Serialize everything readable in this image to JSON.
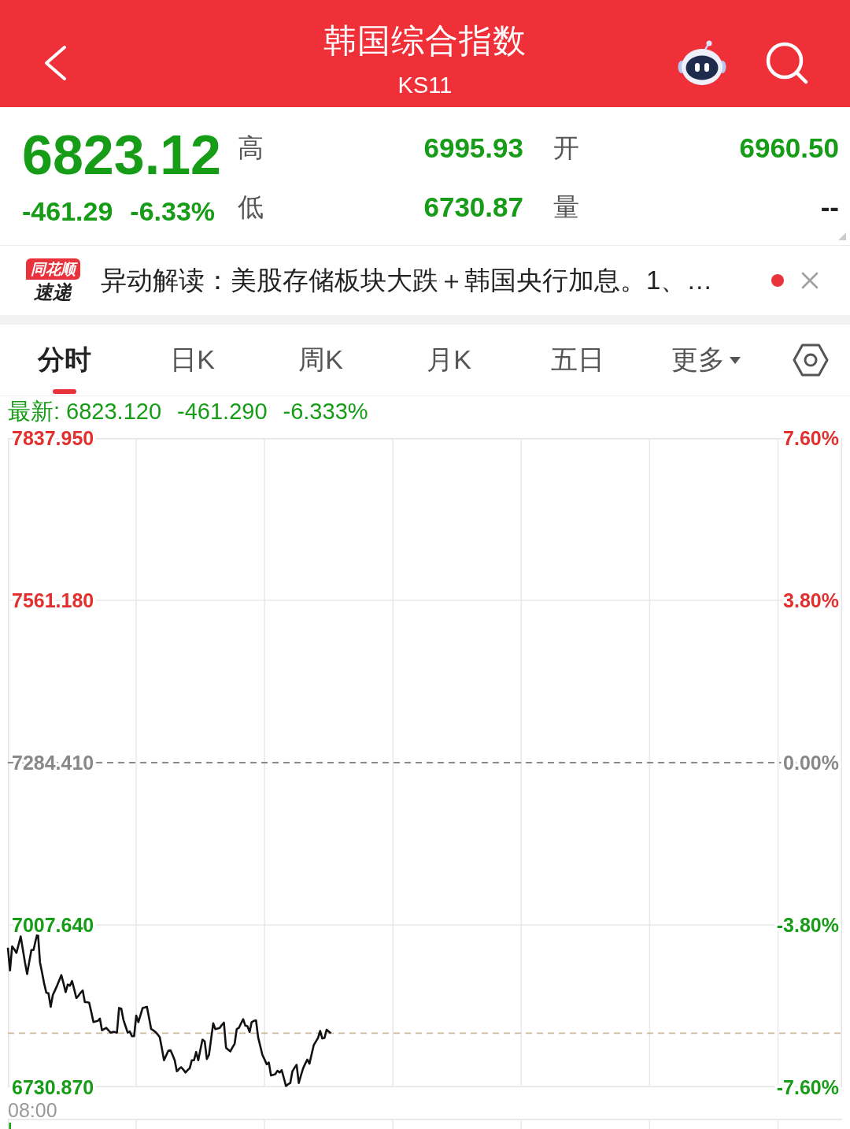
{
  "header": {
    "title": "韩国综合指数",
    "code": "KS11"
  },
  "quote": {
    "price": "6823.12",
    "change": "-461.29",
    "change_pct": "-6.33%",
    "falling": true,
    "stats": [
      {
        "label": "高",
        "value": "6995.93",
        "color": "#169c16"
      },
      {
        "label": "开",
        "value": "6960.50",
        "color": "#169c16"
      },
      {
        "label": "低",
        "value": "6730.87",
        "color": "#169c16"
      },
      {
        "label": "量",
        "value": "--",
        "color": "#222222"
      }
    ]
  },
  "news": {
    "logo_tag": "同花顺",
    "logo_text": "速递",
    "text": "异动解读：美股存储板块大跌＋韩国央行加息。1、…",
    "unread": true
  },
  "tabs": [
    {
      "label": "分时",
      "selected": true,
      "dropdown": false
    },
    {
      "label": "日K",
      "selected": false,
      "dropdown": false
    },
    {
      "label": "周K",
      "selected": false,
      "dropdown": false
    },
    {
      "label": "月K",
      "selected": false,
      "dropdown": false
    },
    {
      "label": "五日",
      "selected": false,
      "dropdown": false
    },
    {
      "label": "更多",
      "selected": false,
      "dropdown": true
    }
  ],
  "chart": {
    "latest_label": "最新:",
    "latest_price": "6823.120",
    "latest_change": "-461.290",
    "latest_pct": "-6.333%",
    "falling": true,
    "right_axis_labels": [
      "7.60%",
      "3.80%",
      "0.00%",
      "-3.80%",
      "-7.60%"
    ],
    "chart_data": {
      "type": "line",
      "ylim": [
        6730.87,
        7837.95
      ],
      "yticks": [
        {
          "value": 7837.95,
          "label": "7837.950"
        },
        {
          "value": 7561.18,
          "label": "7561.180"
        },
        {
          "value": 7284.41,
          "label": "7284.410"
        },
        {
          "value": 7007.64,
          "label": "7007.640"
        },
        {
          "value": 6730.87,
          "label": "6730.870"
        }
      ],
      "ref_lines": [
        {
          "axis": "y",
          "value": 7284.41,
          "color": "#8a8a8a"
        },
        {
          "axis": "y",
          "value": 6823.12,
          "color": "#cdb99a"
        }
      ],
      "annotations": [
        "08:00"
      ],
      "values": [
        6969,
        6930,
        6971,
        6966,
        6960,
        6974,
        6988,
        6966,
        6944,
        6924,
        6945,
        6965,
        6965,
        6981,
        6996,
        6944,
        6926,
        6907,
        6892,
        6891,
        6868,
        6888,
        6896,
        6904,
        6913,
        6922,
        6908,
        6893,
        6906,
        6904,
        6912,
        6898,
        6883,
        6887,
        6892,
        6896,
        6876,
        6876,
        6875,
        6859,
        6842,
        6843,
        6844,
        6848,
        6828,
        6830,
        6832,
        6828,
        6824,
        6825,
        6825,
        6824,
        6866,
        6865,
        6846,
        6835,
        6824,
        6826,
        6818,
        6818,
        6853,
        6842,
        6854,
        6866,
        6867,
        6868,
        6849,
        6830,
        6828,
        6825,
        6821,
        6816,
        6797,
        6777,
        6785,
        6793,
        6794,
        6786,
        6777,
        6758,
        6762,
        6765,
        6761,
        6756,
        6760,
        6763,
        6777,
        6777,
        6791,
        6777,
        6795,
        6812,
        6809,
        6779,
        6786,
        6813,
        6840,
        6830,
        6831,
        6832,
        6837,
        6841,
        6798,
        6795,
        6792,
        6799,
        6805,
        6830,
        6832,
        6840,
        6847,
        6836,
        6835,
        6825,
        6842,
        6844,
        6845,
        6816,
        6801,
        6786,
        6778,
        6770,
        6773,
        6751,
        6752,
        6753,
        6759,
        6756,
        6760,
        6747,
        6733,
        6736,
        6738,
        6758,
        6764,
        6769,
        6738,
        6751,
        6763,
        6771,
        6778,
        6771,
        6787,
        6803,
        6809,
        6815,
        6827,
        6814,
        6815,
        6829,
        6826,
        6823,
        null,
        null,
        null,
        null,
        null,
        null,
        null,
        null,
        null,
        null,
        null,
        null,
        null,
        null,
        null,
        null,
        null,
        null,
        null,
        null,
        null,
        null,
        null,
        null,
        null,
        null,
        null,
        null,
        null,
        null,
        null,
        null,
        null,
        null,
        null,
        null,
        null,
        null,
        null,
        null,
        null,
        null,
        null,
        null,
        null,
        null,
        null,
        null,
        null,
        null,
        null,
        null,
        null,
        null,
        null,
        null,
        null,
        null,
        null,
        null,
        null,
        null,
        null,
        null,
        null,
        null,
        null,
        null,
        null,
        null,
        null,
        null,
        null,
        null,
        null,
        null,
        null,
        null,
        null,
        null,
        null,
        null,
        null,
        null,
        null,
        null,
        null,
        null,
        null,
        null,
        null,
        null,
        null,
        null,
        null,
        null,
        null,
        null,
        null,
        null,
        null,
        null,
        null,
        null,
        null,
        null,
        null,
        null,
        null,
        null,
        null,
        null,
        null,
        null,
        null,
        null,
        null,
        null,
        null,
        null,
        null,
        null,
        null,
        null,
        null,
        null,
        null,
        null,
        null,
        null,
        null,
        null,
        null,
        null,
        null,
        null,
        null,
        null,
        null,
        null,
        null,
        null,
        null,
        null,
        null,
        null,
        null,
        null,
        null,
        null,
        null,
        null,
        null,
        null,
        null,
        null,
        null,
        null,
        null,
        null,
        null,
        null,
        null,
        null,
        null,
        null,
        null,
        null,
        null,
        null,
        null,
        null,
        null,
        null,
        null,
        null,
        null,
        null,
        null,
        null,
        null,
        null,
        null,
        null,
        null,
        null,
        null,
        null,
        null,
        null,
        null,
        null,
        null,
        null,
        null,
        null,
        null,
        null,
        null,
        null,
        null,
        null,
        null,
        null,
        null,
        null,
        null,
        null,
        null,
        null,
        null,
        null,
        null,
        null,
        null,
        null,
        null,
        null,
        null,
        null,
        null,
        null,
        null,
        null,
        null,
        null,
        null,
        null,
        null,
        null,
        null,
        null,
        null,
        null,
        null,
        null,
        null,
        null,
        null
      ]
    }
  }
}
